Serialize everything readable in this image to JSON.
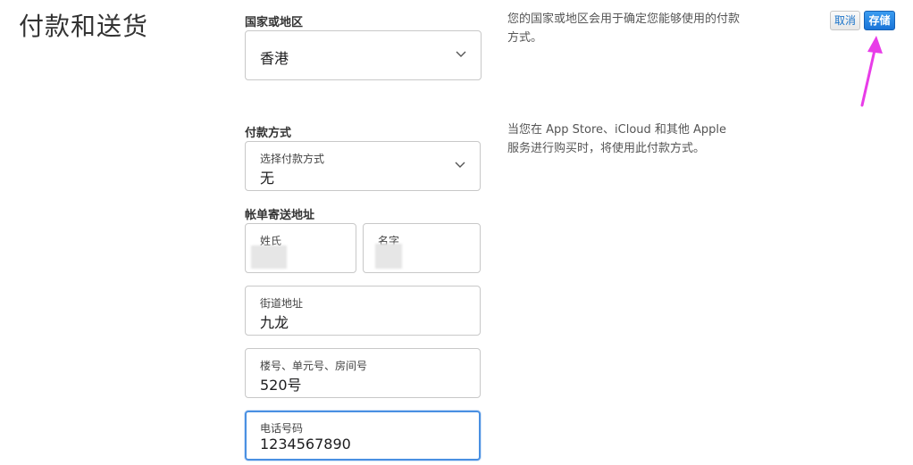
{
  "page": {
    "title": "付款和送货"
  },
  "toolbar": {
    "cancel_label": "取消",
    "save_label": "存储"
  },
  "country": {
    "label": "国家或地区",
    "value": "香港",
    "help": "您的国家或地区会用于确定您能够使用的付款方式。"
  },
  "payment": {
    "label": "付款方式",
    "field_label": "选择付款方式",
    "value": "无",
    "help": "当您在 App Store、iCloud 和其他 Apple 服务进行购买时，将使用此付款方式。"
  },
  "billing": {
    "label": "帐单寄送地址",
    "last_name_label": "姓氏",
    "first_name_label": "名字",
    "street_label": "街道地址",
    "street_value": "九龙",
    "unit_label": "楼号、单元号、房间号",
    "unit_value": "520号",
    "phone_label": "电话号码",
    "phone_value": "1234567890"
  },
  "icons": {
    "chevron": "chevron-down-icon",
    "annotation": "pink-arrow-annotation"
  },
  "colors": {
    "accent": "#1a74d8",
    "annotation": "#e83ce8"
  }
}
